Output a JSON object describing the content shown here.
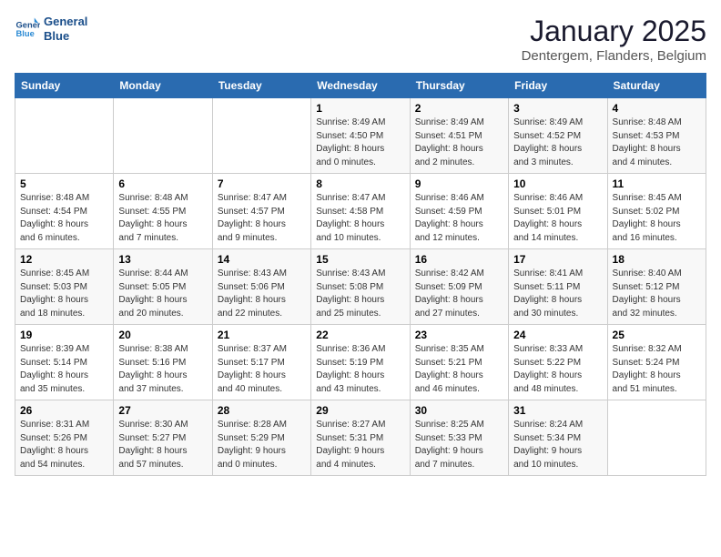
{
  "logo": {
    "line1": "General",
    "line2": "Blue"
  },
  "header": {
    "month": "January 2025",
    "location": "Dentergem, Flanders, Belgium"
  },
  "weekdays": [
    "Sunday",
    "Monday",
    "Tuesday",
    "Wednesday",
    "Thursday",
    "Friday",
    "Saturday"
  ],
  "weeks": [
    [
      {
        "day": "",
        "info": ""
      },
      {
        "day": "",
        "info": ""
      },
      {
        "day": "",
        "info": ""
      },
      {
        "day": "1",
        "info": "Sunrise: 8:49 AM\nSunset: 4:50 PM\nDaylight: 8 hours\nand 0 minutes."
      },
      {
        "day": "2",
        "info": "Sunrise: 8:49 AM\nSunset: 4:51 PM\nDaylight: 8 hours\nand 2 minutes."
      },
      {
        "day": "3",
        "info": "Sunrise: 8:49 AM\nSunset: 4:52 PM\nDaylight: 8 hours\nand 3 minutes."
      },
      {
        "day": "4",
        "info": "Sunrise: 8:48 AM\nSunset: 4:53 PM\nDaylight: 8 hours\nand 4 minutes."
      }
    ],
    [
      {
        "day": "5",
        "info": "Sunrise: 8:48 AM\nSunset: 4:54 PM\nDaylight: 8 hours\nand 6 minutes."
      },
      {
        "day": "6",
        "info": "Sunrise: 8:48 AM\nSunset: 4:55 PM\nDaylight: 8 hours\nand 7 minutes."
      },
      {
        "day": "7",
        "info": "Sunrise: 8:47 AM\nSunset: 4:57 PM\nDaylight: 8 hours\nand 9 minutes."
      },
      {
        "day": "8",
        "info": "Sunrise: 8:47 AM\nSunset: 4:58 PM\nDaylight: 8 hours\nand 10 minutes."
      },
      {
        "day": "9",
        "info": "Sunrise: 8:46 AM\nSunset: 4:59 PM\nDaylight: 8 hours\nand 12 minutes."
      },
      {
        "day": "10",
        "info": "Sunrise: 8:46 AM\nSunset: 5:01 PM\nDaylight: 8 hours\nand 14 minutes."
      },
      {
        "day": "11",
        "info": "Sunrise: 8:45 AM\nSunset: 5:02 PM\nDaylight: 8 hours\nand 16 minutes."
      }
    ],
    [
      {
        "day": "12",
        "info": "Sunrise: 8:45 AM\nSunset: 5:03 PM\nDaylight: 8 hours\nand 18 minutes."
      },
      {
        "day": "13",
        "info": "Sunrise: 8:44 AM\nSunset: 5:05 PM\nDaylight: 8 hours\nand 20 minutes."
      },
      {
        "day": "14",
        "info": "Sunrise: 8:43 AM\nSunset: 5:06 PM\nDaylight: 8 hours\nand 22 minutes."
      },
      {
        "day": "15",
        "info": "Sunrise: 8:43 AM\nSunset: 5:08 PM\nDaylight: 8 hours\nand 25 minutes."
      },
      {
        "day": "16",
        "info": "Sunrise: 8:42 AM\nSunset: 5:09 PM\nDaylight: 8 hours\nand 27 minutes."
      },
      {
        "day": "17",
        "info": "Sunrise: 8:41 AM\nSunset: 5:11 PM\nDaylight: 8 hours\nand 30 minutes."
      },
      {
        "day": "18",
        "info": "Sunrise: 8:40 AM\nSunset: 5:12 PM\nDaylight: 8 hours\nand 32 minutes."
      }
    ],
    [
      {
        "day": "19",
        "info": "Sunrise: 8:39 AM\nSunset: 5:14 PM\nDaylight: 8 hours\nand 35 minutes."
      },
      {
        "day": "20",
        "info": "Sunrise: 8:38 AM\nSunset: 5:16 PM\nDaylight: 8 hours\nand 37 minutes."
      },
      {
        "day": "21",
        "info": "Sunrise: 8:37 AM\nSunset: 5:17 PM\nDaylight: 8 hours\nand 40 minutes."
      },
      {
        "day": "22",
        "info": "Sunrise: 8:36 AM\nSunset: 5:19 PM\nDaylight: 8 hours\nand 43 minutes."
      },
      {
        "day": "23",
        "info": "Sunrise: 8:35 AM\nSunset: 5:21 PM\nDaylight: 8 hours\nand 46 minutes."
      },
      {
        "day": "24",
        "info": "Sunrise: 8:33 AM\nSunset: 5:22 PM\nDaylight: 8 hours\nand 48 minutes."
      },
      {
        "day": "25",
        "info": "Sunrise: 8:32 AM\nSunset: 5:24 PM\nDaylight: 8 hours\nand 51 minutes."
      }
    ],
    [
      {
        "day": "26",
        "info": "Sunrise: 8:31 AM\nSunset: 5:26 PM\nDaylight: 8 hours\nand 54 minutes."
      },
      {
        "day": "27",
        "info": "Sunrise: 8:30 AM\nSunset: 5:27 PM\nDaylight: 8 hours\nand 57 minutes."
      },
      {
        "day": "28",
        "info": "Sunrise: 8:28 AM\nSunset: 5:29 PM\nDaylight: 9 hours\nand 0 minutes."
      },
      {
        "day": "29",
        "info": "Sunrise: 8:27 AM\nSunset: 5:31 PM\nDaylight: 9 hours\nand 4 minutes."
      },
      {
        "day": "30",
        "info": "Sunrise: 8:25 AM\nSunset: 5:33 PM\nDaylight: 9 hours\nand 7 minutes."
      },
      {
        "day": "31",
        "info": "Sunrise: 8:24 AM\nSunset: 5:34 PM\nDaylight: 9 hours\nand 10 minutes."
      },
      {
        "day": "",
        "info": ""
      }
    ]
  ]
}
